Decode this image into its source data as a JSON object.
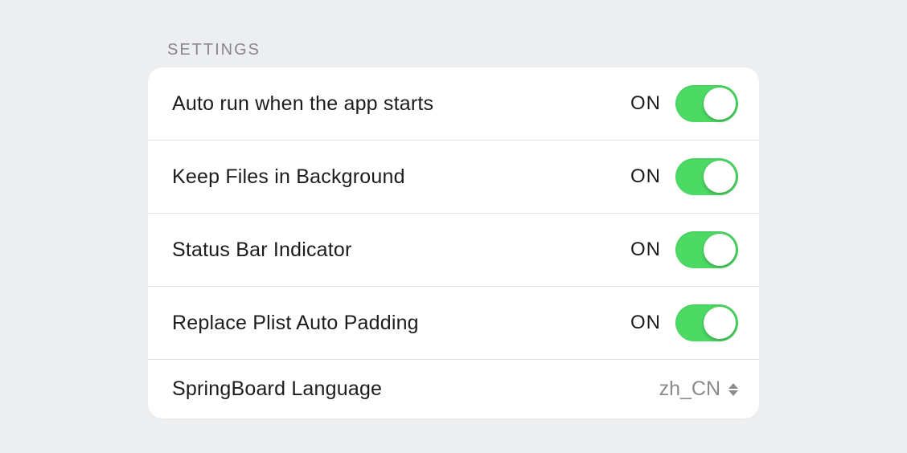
{
  "section": {
    "title": "SETTINGS"
  },
  "rows": [
    {
      "label": "Auto run when the app starts",
      "state": "ON"
    },
    {
      "label": "Keep Files in Background",
      "state": "ON"
    },
    {
      "label": "Status Bar Indicator",
      "state": "ON"
    },
    {
      "label": "Replace Plist Auto Padding",
      "state": "ON"
    }
  ],
  "language": {
    "label": "SpringBoard Language",
    "value": "zh_CN"
  },
  "colors": {
    "toggleOn": "#4cd964",
    "background": "#eceef0"
  }
}
